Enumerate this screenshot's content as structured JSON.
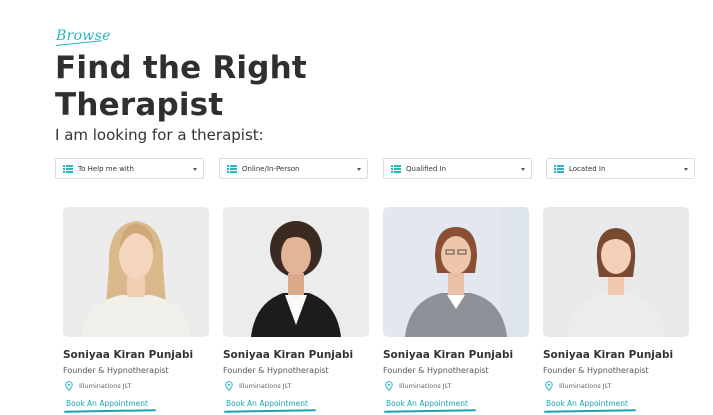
{
  "header": {
    "eyebrow": "Browse",
    "title": "Find the Right Therapist",
    "subtitle": "I am looking for a therapist:"
  },
  "filters": [
    {
      "label": "To Help me with",
      "icon": "list-icon"
    },
    {
      "label": "Online/In-Person",
      "icon": "list-icon"
    },
    {
      "label": "Qualified In",
      "icon": "list-icon"
    },
    {
      "label": "Located In",
      "icon": "list-icon"
    }
  ],
  "therapists": [
    {
      "name": "Soniyaa Kiran Punjabi",
      "role": "Founder & Hypnotherapist",
      "location": "Illuminations JLT",
      "cta": "Book An Appointment"
    },
    {
      "name": "Soniyaa Kiran Punjabi",
      "role": "Founder & Hypnotherapist",
      "location": "Illuminations JLT",
      "cta": "Book An Appointment"
    },
    {
      "name": "Soniyaa Kiran Punjabi",
      "role": "Founder & Hypnotherapist",
      "location": "Illuminations JLT",
      "cta": "Book An Appointment"
    },
    {
      "name": "Soniyaa Kiran Punjabi",
      "role": "Founder & Hypnotherapist",
      "location": "Illuminations JLT",
      "cta": "Book An Appointment"
    }
  ],
  "colors": {
    "accent": "#2bb3c0",
    "link": "#1aa3b2",
    "text": "#2f2f2f"
  }
}
